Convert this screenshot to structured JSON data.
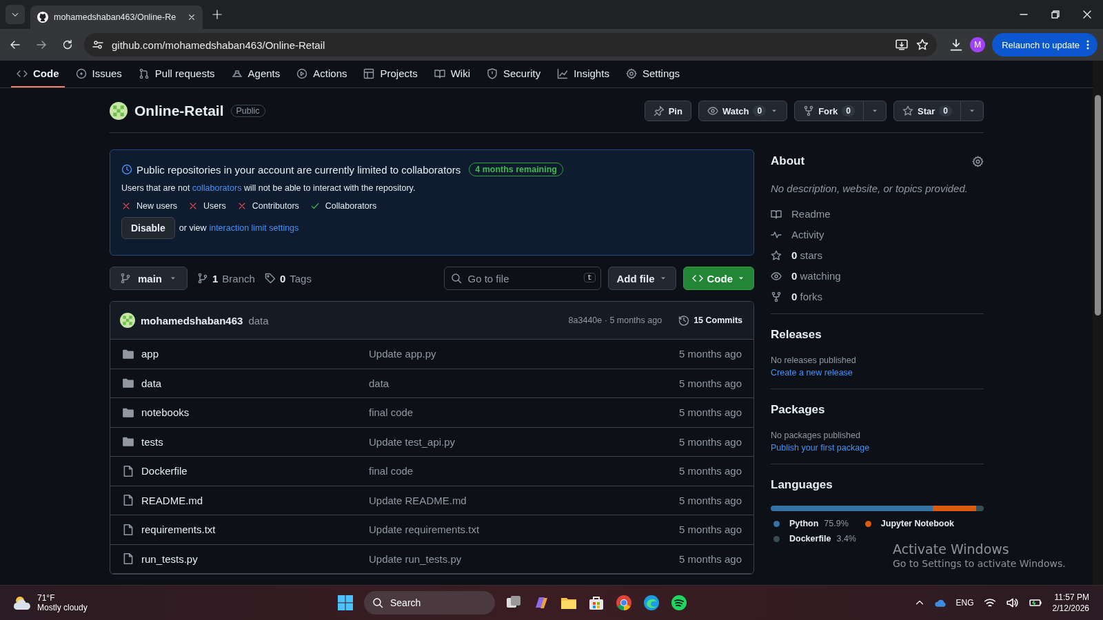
{
  "browser": {
    "tabs": [
      {
        "title": "mohamedshaban463/Online-Re",
        "selected": true
      }
    ],
    "url": "github.com/mohamedshaban463/Online-Retail",
    "profile_initial": "M",
    "relaunch_button": "Relaunch to update"
  },
  "repo_nav": [
    {
      "label": "Code",
      "kind": "code",
      "selected": true
    },
    {
      "label": "Issues",
      "kind": "issues",
      "selected": false
    },
    {
      "label": "Pull requests",
      "kind": "pr",
      "selected": false
    },
    {
      "label": "Agents",
      "kind": "agents",
      "selected": false
    },
    {
      "label": "Actions",
      "kind": "actions",
      "selected": false
    },
    {
      "label": "Projects",
      "kind": "projects",
      "selected": false
    },
    {
      "label": "Wiki",
      "kind": "wiki",
      "selected": false
    },
    {
      "label": "Security",
      "kind": "security",
      "selected": false
    },
    {
      "label": "Insights",
      "kind": "insights",
      "selected": false
    },
    {
      "label": "Settings",
      "kind": "settings",
      "selected": false
    }
  ],
  "repo": {
    "name": "Online-Retail",
    "visibility": "Public",
    "buttons": [
      {
        "label": "Pin",
        "kind": "pin",
        "split": false
      },
      {
        "label": "Watch",
        "kind": "watch",
        "count": "0",
        "split": false
      },
      {
        "label": "Fork",
        "kind": "fork",
        "count": "0",
        "split": true
      },
      {
        "label": "Star",
        "kind": "star",
        "count": "0",
        "split": true
      }
    ]
  },
  "banner": {
    "title": "Public repositories in your account are currently limited to collaborators",
    "badge": "4 months remaining",
    "message_before": "Users that are not ",
    "message_link": "collaborators",
    "message_after": " will not be able to interact with the repository.",
    "restrictions": [
      {
        "label": "New users",
        "allowed": false
      },
      {
        "label": "Users",
        "allowed": false
      },
      {
        "label": "Contributors",
        "allowed": false
      },
      {
        "label": "Collaborators",
        "allowed": true
      }
    ],
    "disable_button": "Disable",
    "view_text": "or view",
    "view_link": "interaction limit settings"
  },
  "toolbar": {
    "branch": "main",
    "branch_count": "1",
    "branch_label": "Branch",
    "tag_count": "0",
    "tag_label": "Tags",
    "search_placeholder": "Go to file",
    "shortcut": "t",
    "add_file": "Add file",
    "code_button": "Code"
  },
  "commit": {
    "author": "mohamedshaban463",
    "message": "data",
    "hash_time": "8a3440e · 5 months ago",
    "commits": "15 Commits"
  },
  "files": [
    {
      "name": "app",
      "kind": "folder",
      "message": "Update app.py",
      "time": "5 months ago"
    },
    {
      "name": "data",
      "kind": "folder",
      "message": "data",
      "time": "5 months ago"
    },
    {
      "name": "notebooks",
      "kind": "folder",
      "message": "final code",
      "time": "5 months ago"
    },
    {
      "name": "tests",
      "kind": "folder",
      "message": "Update test_api.py",
      "time": "5 months ago"
    },
    {
      "name": "Dockerfile",
      "kind": "file",
      "message": "final code",
      "time": "5 months ago"
    },
    {
      "name": "README.md",
      "kind": "file",
      "message": "Update README.md",
      "time": "5 months ago"
    },
    {
      "name": "requirements.txt",
      "kind": "file",
      "message": "Update requirements.txt",
      "time": "5 months ago"
    },
    {
      "name": "run_tests.py",
      "kind": "file",
      "message": "Update run_tests.py",
      "time": "5 months ago"
    }
  ],
  "about": {
    "title": "About",
    "description": "No description, website, or topics provided.",
    "links": [
      {
        "label": "Readme",
        "kind": "readme"
      },
      {
        "label": "Activity",
        "kind": "activity"
      },
      {
        "label": "**0** stars",
        "kind": "stars"
      },
      {
        "label": "**0** watching",
        "kind": "watching"
      },
      {
        "label": "**0** forks",
        "kind": "forks"
      }
    ]
  },
  "releases": {
    "title": "Releases",
    "text": "No releases published",
    "link": "Create a new release"
  },
  "packages": {
    "title": "Packages",
    "text": "No packages published",
    "link": "Publish your first package"
  },
  "languages": {
    "title": "Languages",
    "items": [
      {
        "name": "Python",
        "percent": "75.9%",
        "color": "#3572a5",
        "level": 0.759
      },
      {
        "name": "Jupyter Notebook",
        "color": "#da5b0b"
      },
      {
        "name": "Dockerfile",
        "percent": "3.4%",
        "color": "#384d54",
        "level": 0.034
      }
    ]
  },
  "activation": {
    "title": "Activate Windows",
    "text": "Go to Settings to activate Windows."
  },
  "taskbar": {
    "temperature": "71°F",
    "weather": "Mostly cloudy",
    "search": "Search",
    "language": "ENG",
    "time": "11:57 PM",
    "date": "2/12/2026"
  }
}
